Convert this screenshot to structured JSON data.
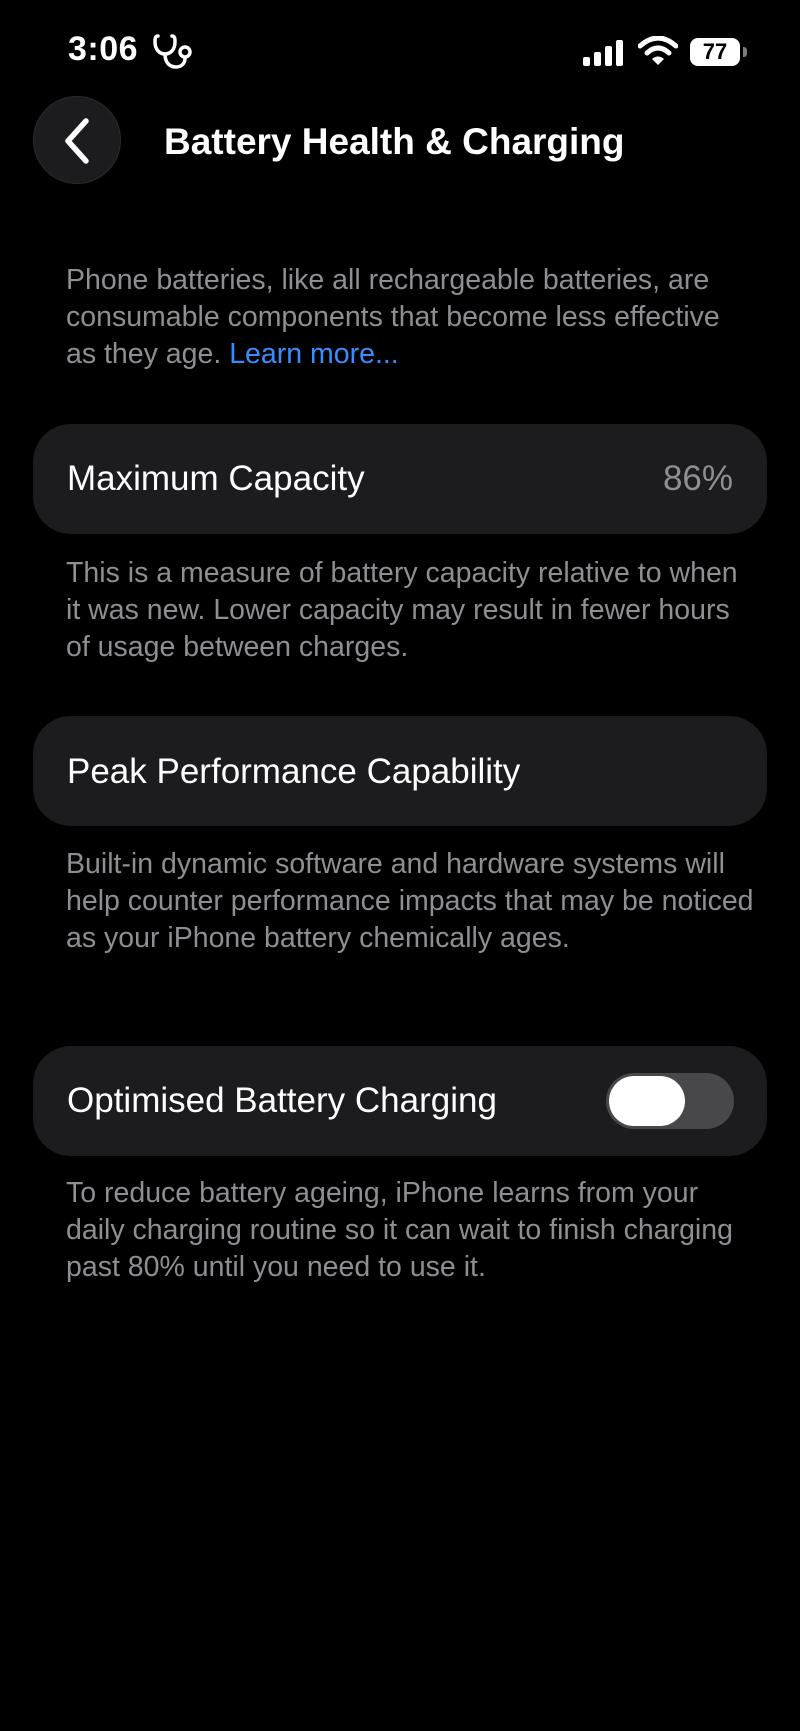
{
  "status_bar": {
    "time": "3:06",
    "battery_level": "77"
  },
  "header": {
    "title": "Battery Health & Charging"
  },
  "intro": {
    "text": "Phone batteries, like all rechargeable batteries, are consumable components that become less effective as they age. ",
    "link": "Learn more..."
  },
  "maximum_capacity": {
    "label": "Maximum Capacity",
    "value": "86%",
    "description": "This is a measure of battery capacity relative to when it was new. Lower capacity may result in fewer hours of usage between charges."
  },
  "peak_performance": {
    "label": "Peak Performance Capability",
    "description": "Built-in dynamic software and hardware systems will help counter performance impacts that may be noticed as your iPhone battery chemically ages."
  },
  "optimised_charging": {
    "label": "Optimised Battery Charging",
    "enabled": false,
    "description": "To reduce battery ageing, iPhone learns from your daily charging routine so it can wait to finish charging past 80% until you need to use it."
  }
}
